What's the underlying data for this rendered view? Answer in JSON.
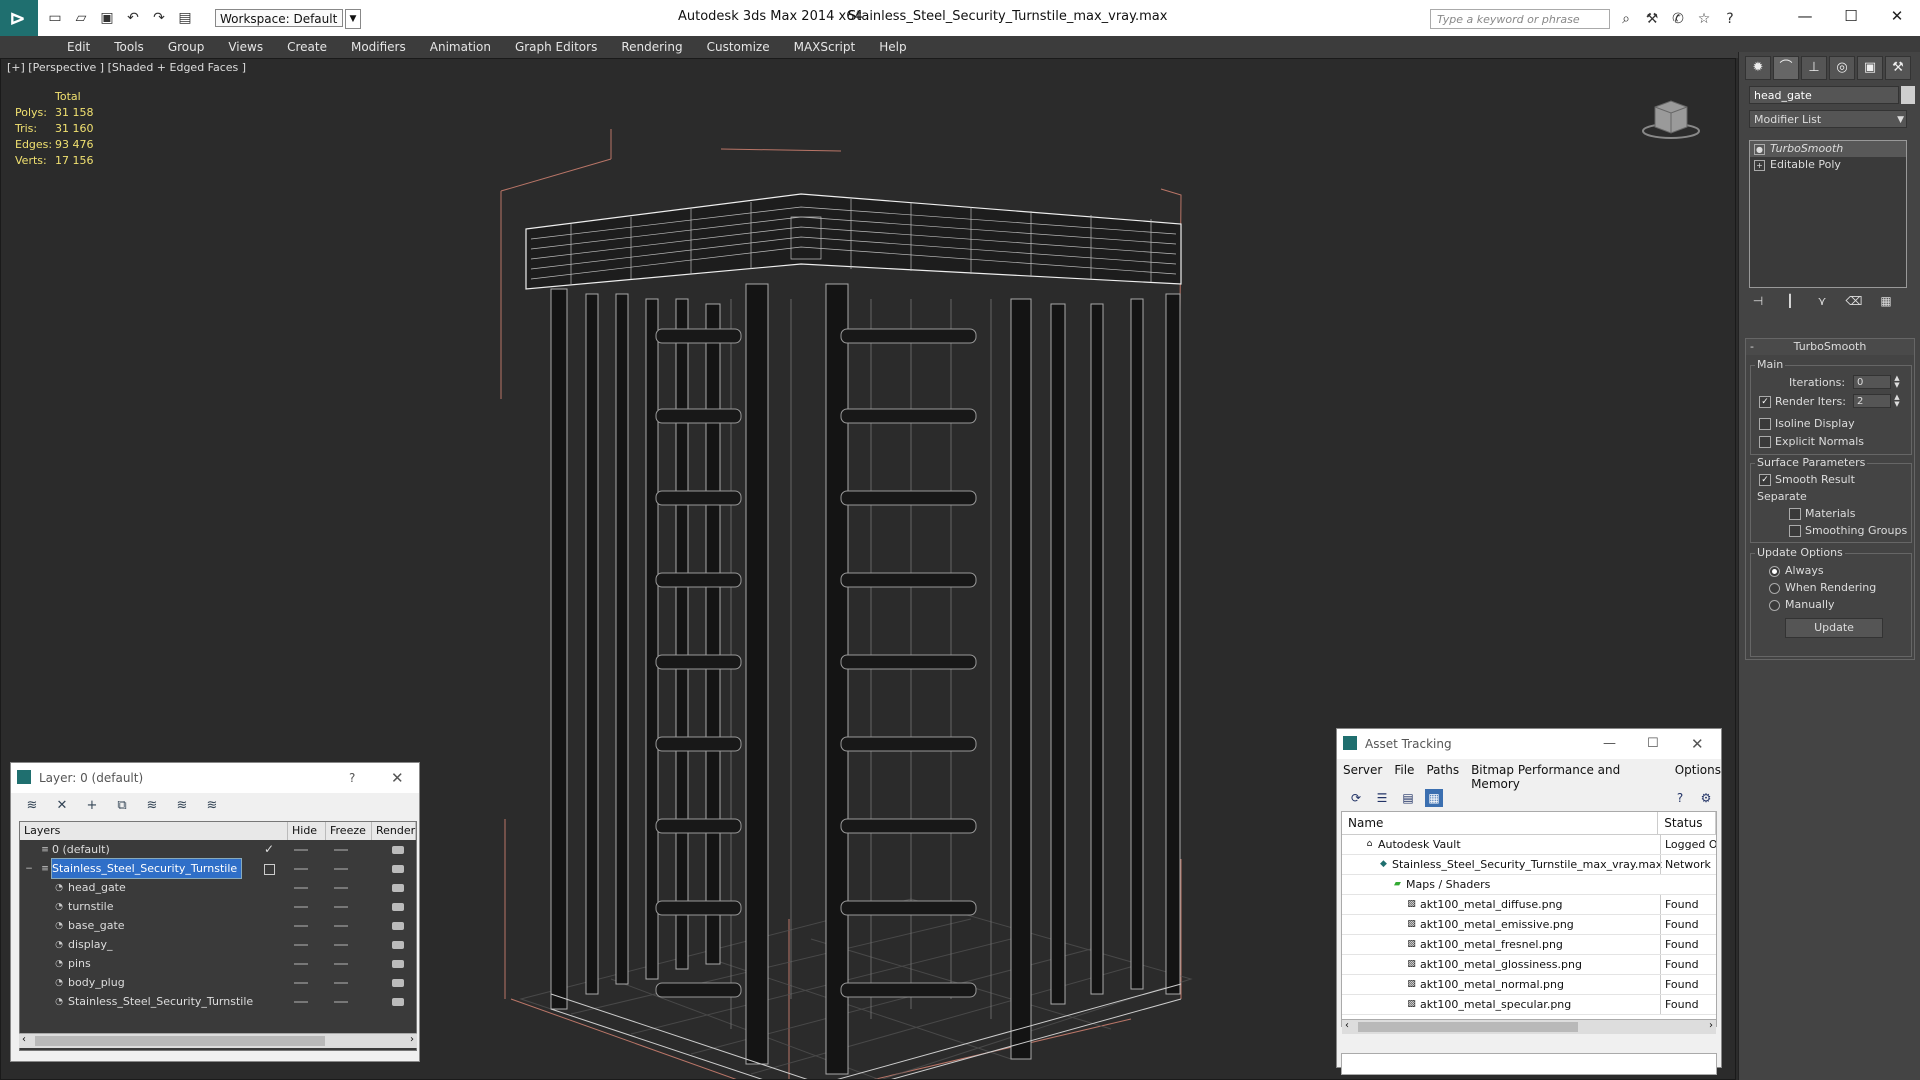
{
  "titlebar": {
    "workspace": "Workspace: Default",
    "app_title": "Autodesk 3ds Max  2014 x64",
    "file_title": "Stainless_Steel_Security_Turnstile_max_vray.max",
    "search_placeholder": "Type a keyword or phrase"
  },
  "menu": [
    "Edit",
    "Tools",
    "Group",
    "Views",
    "Create",
    "Modifiers",
    "Animation",
    "Graph Editors",
    "Rendering",
    "Customize",
    "MAXScript",
    "Help"
  ],
  "viewport": {
    "label": "[+] [Perspective ] [Shaded + Edged Faces ]",
    "stats_header": "Total",
    "stats": [
      {
        "k": "Polys:",
        "v": "31 158"
      },
      {
        "k": "Tris:",
        "v": "31 160"
      },
      {
        "k": "Edges:",
        "v": "93 476"
      },
      {
        "k": "Verts:",
        "v": "17 156"
      }
    ]
  },
  "command_panel": {
    "object_name": "head_gate",
    "modifier_list": "Modifier List",
    "stack": [
      {
        "label": "TurboSmooth",
        "selected": true
      },
      {
        "label": "Editable Poly",
        "selected": false
      }
    ],
    "rollout_title": "TurboSmooth",
    "rollout_marker": "-",
    "main_group": "Main",
    "iterations_label": "Iterations:",
    "iterations_value": "0",
    "render_iters_label": "Render Iters:",
    "render_iters_value": "2",
    "isoline_label": "Isoline Display",
    "explicit_normals_label": "Explicit Normals",
    "surface_group": "Surface Parameters",
    "smooth_result_label": "Smooth Result",
    "separate_label": "Separate",
    "materials_label": "Materials",
    "smoothing_groups_label": "Smoothing Groups",
    "update_group": "Update Options",
    "always_label": "Always",
    "when_rendering_label": "When Rendering",
    "manually_label": "Manually",
    "update_button": "Update"
  },
  "layers_window": {
    "title": "Layer: 0 (default)",
    "help": "?",
    "columns": [
      "Layers",
      "Hide",
      "Freeze",
      "Render"
    ],
    "rows": [
      {
        "name": "0 (default)",
        "indent": 1,
        "selected": false,
        "current": true
      },
      {
        "name": "Stainless_Steel_Security_Turnstile",
        "indent": 1,
        "selected": true,
        "current": false
      },
      {
        "name": "head_gate",
        "indent": 2,
        "selected": false,
        "current": false
      },
      {
        "name": "turnstile",
        "indent": 2,
        "selected": false,
        "current": false
      },
      {
        "name": "base_gate",
        "indent": 2,
        "selected": false,
        "current": false
      },
      {
        "name": "display_",
        "indent": 2,
        "selected": false,
        "current": false
      },
      {
        "name": "pins",
        "indent": 2,
        "selected": false,
        "current": false
      },
      {
        "name": "body_plug",
        "indent": 2,
        "selected": false,
        "current": false
      },
      {
        "name": "Stainless_Steel_Security_Turnstile",
        "indent": 2,
        "selected": false,
        "current": false
      }
    ]
  },
  "asset_window": {
    "title": "Asset Tracking",
    "menu": [
      "Server",
      "File",
      "Paths",
      "Bitmap Performance and Memory",
      "Options"
    ],
    "columns": [
      "Name",
      "Status"
    ],
    "rows": [
      {
        "name": "Autodesk Vault",
        "status": "Logged O",
        "indent": 1
      },
      {
        "name": "Stainless_Steel_Security_Turnstile_max_vray.max",
        "status": "Network",
        "indent": 2
      },
      {
        "name": "Maps / Shaders",
        "status": "",
        "indent": 3
      },
      {
        "name": "akt100_metal_diffuse.png",
        "status": "Found",
        "indent": 4
      },
      {
        "name": "akt100_metal_emissive.png",
        "status": "Found",
        "indent": 4
      },
      {
        "name": "akt100_metal_fresnel.png",
        "status": "Found",
        "indent": 4
      },
      {
        "name": "akt100_metal_glossiness.png",
        "status": "Found",
        "indent": 4
      },
      {
        "name": "akt100_metal_normal.png",
        "status": "Found",
        "indent": 4
      },
      {
        "name": "akt100_metal_specular.png",
        "status": "Found",
        "indent": 4
      }
    ]
  },
  "colors": {
    "accent": "#2f6fc8",
    "stats": "#f0e070",
    "teal": "#1f6f6f"
  }
}
